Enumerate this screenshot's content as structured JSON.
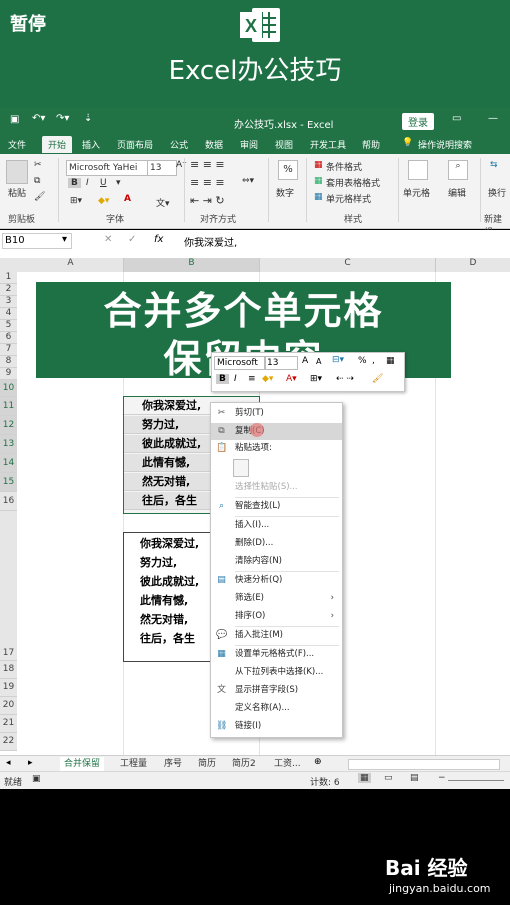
{
  "overlay": {
    "pause": "暂停",
    "brand_title": "Excel办公技巧",
    "logo_letter": "X"
  },
  "titlebar": {
    "filename": "办公技巧.xlsx - Excel",
    "login": "登录"
  },
  "ribbon_tabs": [
    "文件",
    "开始",
    "插入",
    "页面布局",
    "公式",
    "数据",
    "审阅",
    "视图",
    "开发工具",
    "帮助"
  ],
  "ribbon_tab_active": "开始",
  "tell_me": "操作说明搜索",
  "ribbon": {
    "paste": "粘贴",
    "font_name": "Microsoft YaHei",
    "font_size": "13",
    "bold": "B",
    "italic": "I",
    "underline": "U",
    "font_color_letter": "A",
    "number_label": "数字",
    "number_icon": "%",
    "cond_format": "条件格式",
    "table_format": "套用表格格式",
    "cell_style": "单元格样式",
    "cells_label": "单元格",
    "edit_label": "编辑",
    "wrap_label": "换行",
    "groups": {
      "clipboard": "剪贴板",
      "font": "字体",
      "align": "对齐方式",
      "style": "样式",
      "new_group": "新建组"
    }
  },
  "formula_bar": {
    "name_box": "B10",
    "fx": "fx",
    "content": "你我深爱过,"
  },
  "columns": [
    "A",
    "B",
    "C",
    "D"
  ],
  "rows": [
    "1",
    "2",
    "3",
    "4",
    "5",
    "6",
    "7",
    "8",
    "9",
    "10",
    "11",
    "12",
    "13",
    "14",
    "15",
    "16",
    "17",
    "18",
    "19",
    "20",
    "21",
    "22"
  ],
  "title_box": {
    "line1": "合并多个单元格",
    "line2": "保留内容"
  },
  "cells_a": [
    "你我深爱过,",
    "努力过,",
    "彼此成就过,",
    "此情有憾,",
    "然无对错,",
    "往后，各生"
  ],
  "cells_b": [
    "你我深爱过,",
    "努力过,",
    "彼此成就过,",
    "此情有憾,",
    "然无对错,",
    "往后，各生"
  ],
  "mini_toolbar": {
    "font": "Microsoft",
    "size": "13",
    "bold": "B",
    "italic": "I",
    "percent": "%",
    "grow": "A",
    "shrink": "A"
  },
  "context_menu": {
    "cut": "剪切(T)",
    "copy": "复制(C)",
    "paste_options": "粘贴选项:",
    "paste_special": "选择性粘贴(S)...",
    "smart_lookup": "智能查找(L)",
    "insert": "插入(I)...",
    "delete": "删除(D)...",
    "clear": "清除内容(N)",
    "quick_analysis": "快速分析(Q)",
    "filter": "筛选(E)",
    "sort": "排序(O)",
    "insert_comment": "插入批注(M)",
    "format_cells": "设置单元格格式(F)...",
    "pick_list": "从下拉列表中选择(K)...",
    "phonetic": "显示拼音字段(S)",
    "define_name": "定义名称(A)...",
    "link": "链接(I)"
  },
  "sheet_tabs": [
    "合并保留",
    "工程量",
    "序号",
    "简历",
    "简历2",
    "工资..."
  ],
  "sheet_tab_active": "合并保留",
  "status": {
    "mode": "就绪",
    "count": "计数: 6"
  },
  "watermark": {
    "brand": "Bai 经验",
    "url": "jingyan.baidu.com"
  }
}
